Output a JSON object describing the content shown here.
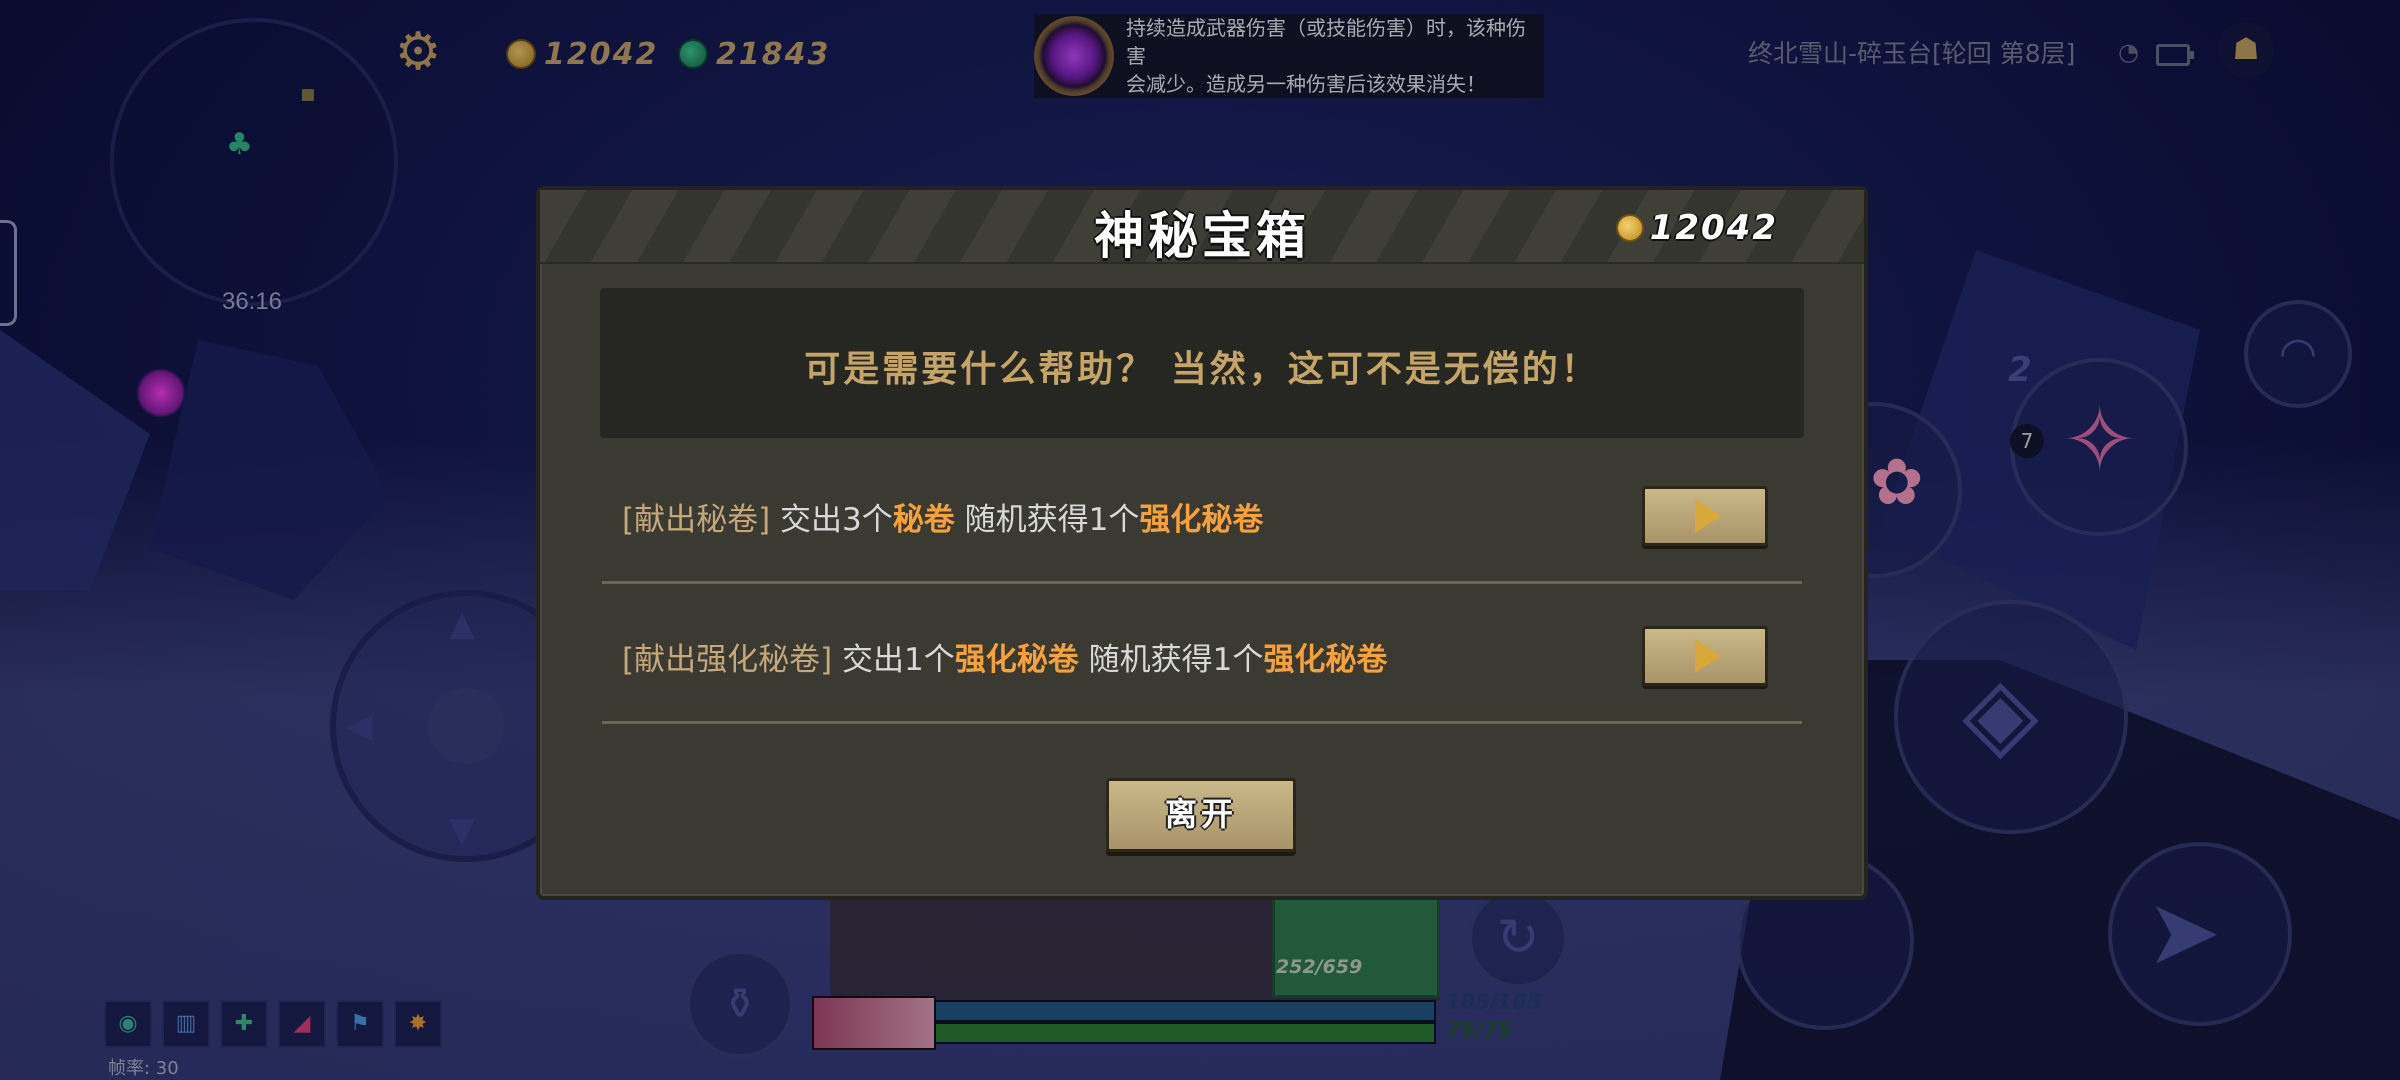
{
  "hud": {
    "timer": "36:16",
    "gold": "12042",
    "gems": "21843",
    "location": "终北雪山-碎玉台[轮回  第8层]",
    "fps_label": "帧率: 30",
    "ammo": "252/659",
    "shield": "105/105",
    "hp": "75/75",
    "weapon_slot_count": "2",
    "weapon_slot_badge": "7"
  },
  "buff_tooltip": {
    "line1": "持续造成武器伤害（或技能伤害）时，该种伤害",
    "line2": "会减少。造成另一种伤害后该效果消失！"
  },
  "modal": {
    "title": "神秘宝箱",
    "coins": "12042",
    "dialog": "可是需要什么帮助？ 当然，这可不是无偿的！",
    "options": [
      {
        "tag": "[献出秘卷]",
        "text_a": " 交出3个",
        "hl_a": "秘卷",
        "text_b": "  随机获得1个",
        "hl_b": "强化秘卷"
      },
      {
        "tag": "[献出强化秘卷]",
        "text_a": " 交出1个",
        "hl_a": "强化秘卷",
        "text_b": "  随机获得1个",
        "hl_b": "强化秘卷"
      }
    ],
    "leave_label": "离开"
  },
  "icons": {
    "settings": "gear-icon",
    "gold": "gold-coin-icon",
    "gem": "gem-icon",
    "buff": "purple-flame-buff-icon",
    "social": "friends-icon",
    "play": "play-triangle-icon"
  },
  "colors": {
    "panel_bg": "#3a3a33",
    "dialog_text": "#c5a566",
    "highlight": "#f6a13a",
    "button_face": "#b9a678"
  }
}
